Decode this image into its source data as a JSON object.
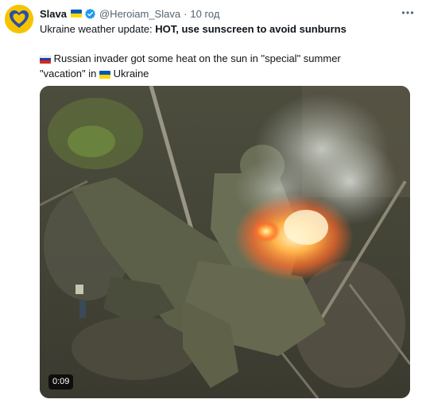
{
  "tweet": {
    "display_name": "Slava",
    "handle": "@Heroiam_Slava",
    "separator": "·",
    "time": "10 год",
    "line1_prefix": "Ukraine weather update: ",
    "line1_bold": "HOT, use sunscreen to avoid sunburns",
    "line2_text_a": " Russian invader got some heat on the sun in \"special\" summer \"vacation\" in ",
    "line2_text_b": " Ukraine",
    "video_duration": "0:09"
  },
  "icons": {
    "avatar": "heart-logo-icon",
    "name_flag": "ukraine-flag-icon",
    "verified": "verified-badge-icon",
    "more": "more-horizontal-icon",
    "russia_flag": "russia-flag-icon",
    "ukraine_flag": "ukraine-flag-icon"
  },
  "colors": {
    "text": "#0f1419",
    "secondary": "#536471",
    "verified": "#1d9bf0",
    "ukraine_blue": "#0057b7",
    "ukraine_yellow": "#ffd700",
    "avatar_bg": "#f5c400"
  }
}
